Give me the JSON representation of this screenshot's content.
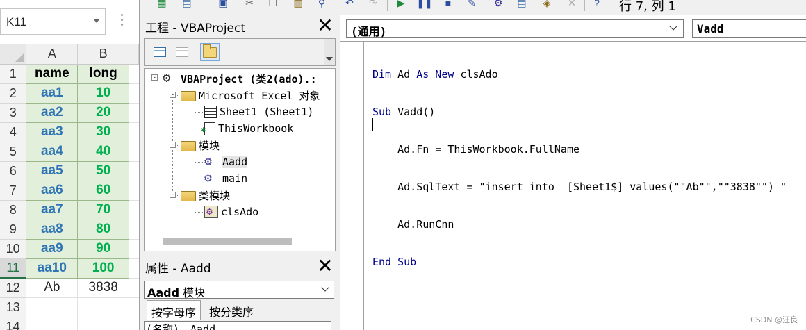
{
  "excel": {
    "name_box": "K11",
    "columns": [
      "A",
      "B"
    ],
    "rows": [
      {
        "num": "1",
        "a": "name",
        "b": "long"
      },
      {
        "num": "2",
        "a": "aa1",
        "b": "10"
      },
      {
        "num": "3",
        "a": "aa2",
        "b": "20"
      },
      {
        "num": "4",
        "a": "aa3",
        "b": "30"
      },
      {
        "num": "5",
        "a": "aa4",
        "b": "40"
      },
      {
        "num": "6",
        "a": "aa5",
        "b": "50"
      },
      {
        "num": "7",
        "a": "aa6",
        "b": "60"
      },
      {
        "num": "8",
        "a": "aa7",
        "b": "70"
      },
      {
        "num": "9",
        "a": "aa8",
        "b": "80"
      },
      {
        "num": "10",
        "a": "aa9",
        "b": "90"
      },
      {
        "num": "11",
        "a": "aa10",
        "b": "100"
      },
      {
        "num": "12",
        "a": "Ab",
        "b": "3838"
      },
      {
        "num": "13",
        "a": "",
        "b": ""
      },
      {
        "num": "14",
        "a": "",
        "b": ""
      }
    ],
    "colors": {
      "name_text": "#2f75b5",
      "long_text": "#00b050",
      "table_fill": "#e2efda",
      "selected_row_header": "#217346"
    }
  },
  "vbe": {
    "status_position": "行 7, 列 1",
    "project_panel": {
      "title": "工程 - VBAProject",
      "close": "✕",
      "tree": {
        "root": "VBAProject (类2(ado).:",
        "excel_objects": "Microsoft Excel 对象",
        "sheet1": "Sheet1 (Sheet1)",
        "thisworkbook": "ThisWorkbook",
        "modules": "模块",
        "aadd": "Aadd",
        "main": "main",
        "class_modules": "类模块",
        "clsado": "clsAdo"
      }
    },
    "properties_panel": {
      "title": "属性 - Aadd",
      "close": "✕",
      "object_name": "Aadd",
      "object_type": " 模块",
      "tab_alpha": "按字母序",
      "tab_category": "按分类序",
      "row_key": "(名称)",
      "row_value": "Aadd"
    },
    "code_window": {
      "object_dropdown": "(通用)",
      "procedure_dropdown": "Vadd",
      "lines": [
        {
          "kw1": "Dim ",
          "t1": "Ad ",
          "kw2": "As New ",
          "t2": "clsAdo"
        },
        {
          "kw1": "Sub ",
          "t1": "Vadd()",
          "kw2": "",
          "t2": ""
        },
        {
          "kw1": "",
          "t1": "    Ad.Fn = ThisWorkbook.FullName",
          "kw2": "",
          "t2": ""
        },
        {
          "kw1": "",
          "t1": "    Ad.SqlText = \"insert into  [Sheet1$] values(\"\"Ab\"\",\"\"3838\"\") \"",
          "kw2": "",
          "t2": ""
        },
        {
          "kw1": "",
          "t1": "    Ad.RunCnn",
          "kw2": "",
          "t2": ""
        },
        {
          "kw1": "End Sub",
          "t1": "",
          "kw2": "",
          "t2": ""
        }
      ]
    }
  },
  "watermark": "CSDN @汪良"
}
